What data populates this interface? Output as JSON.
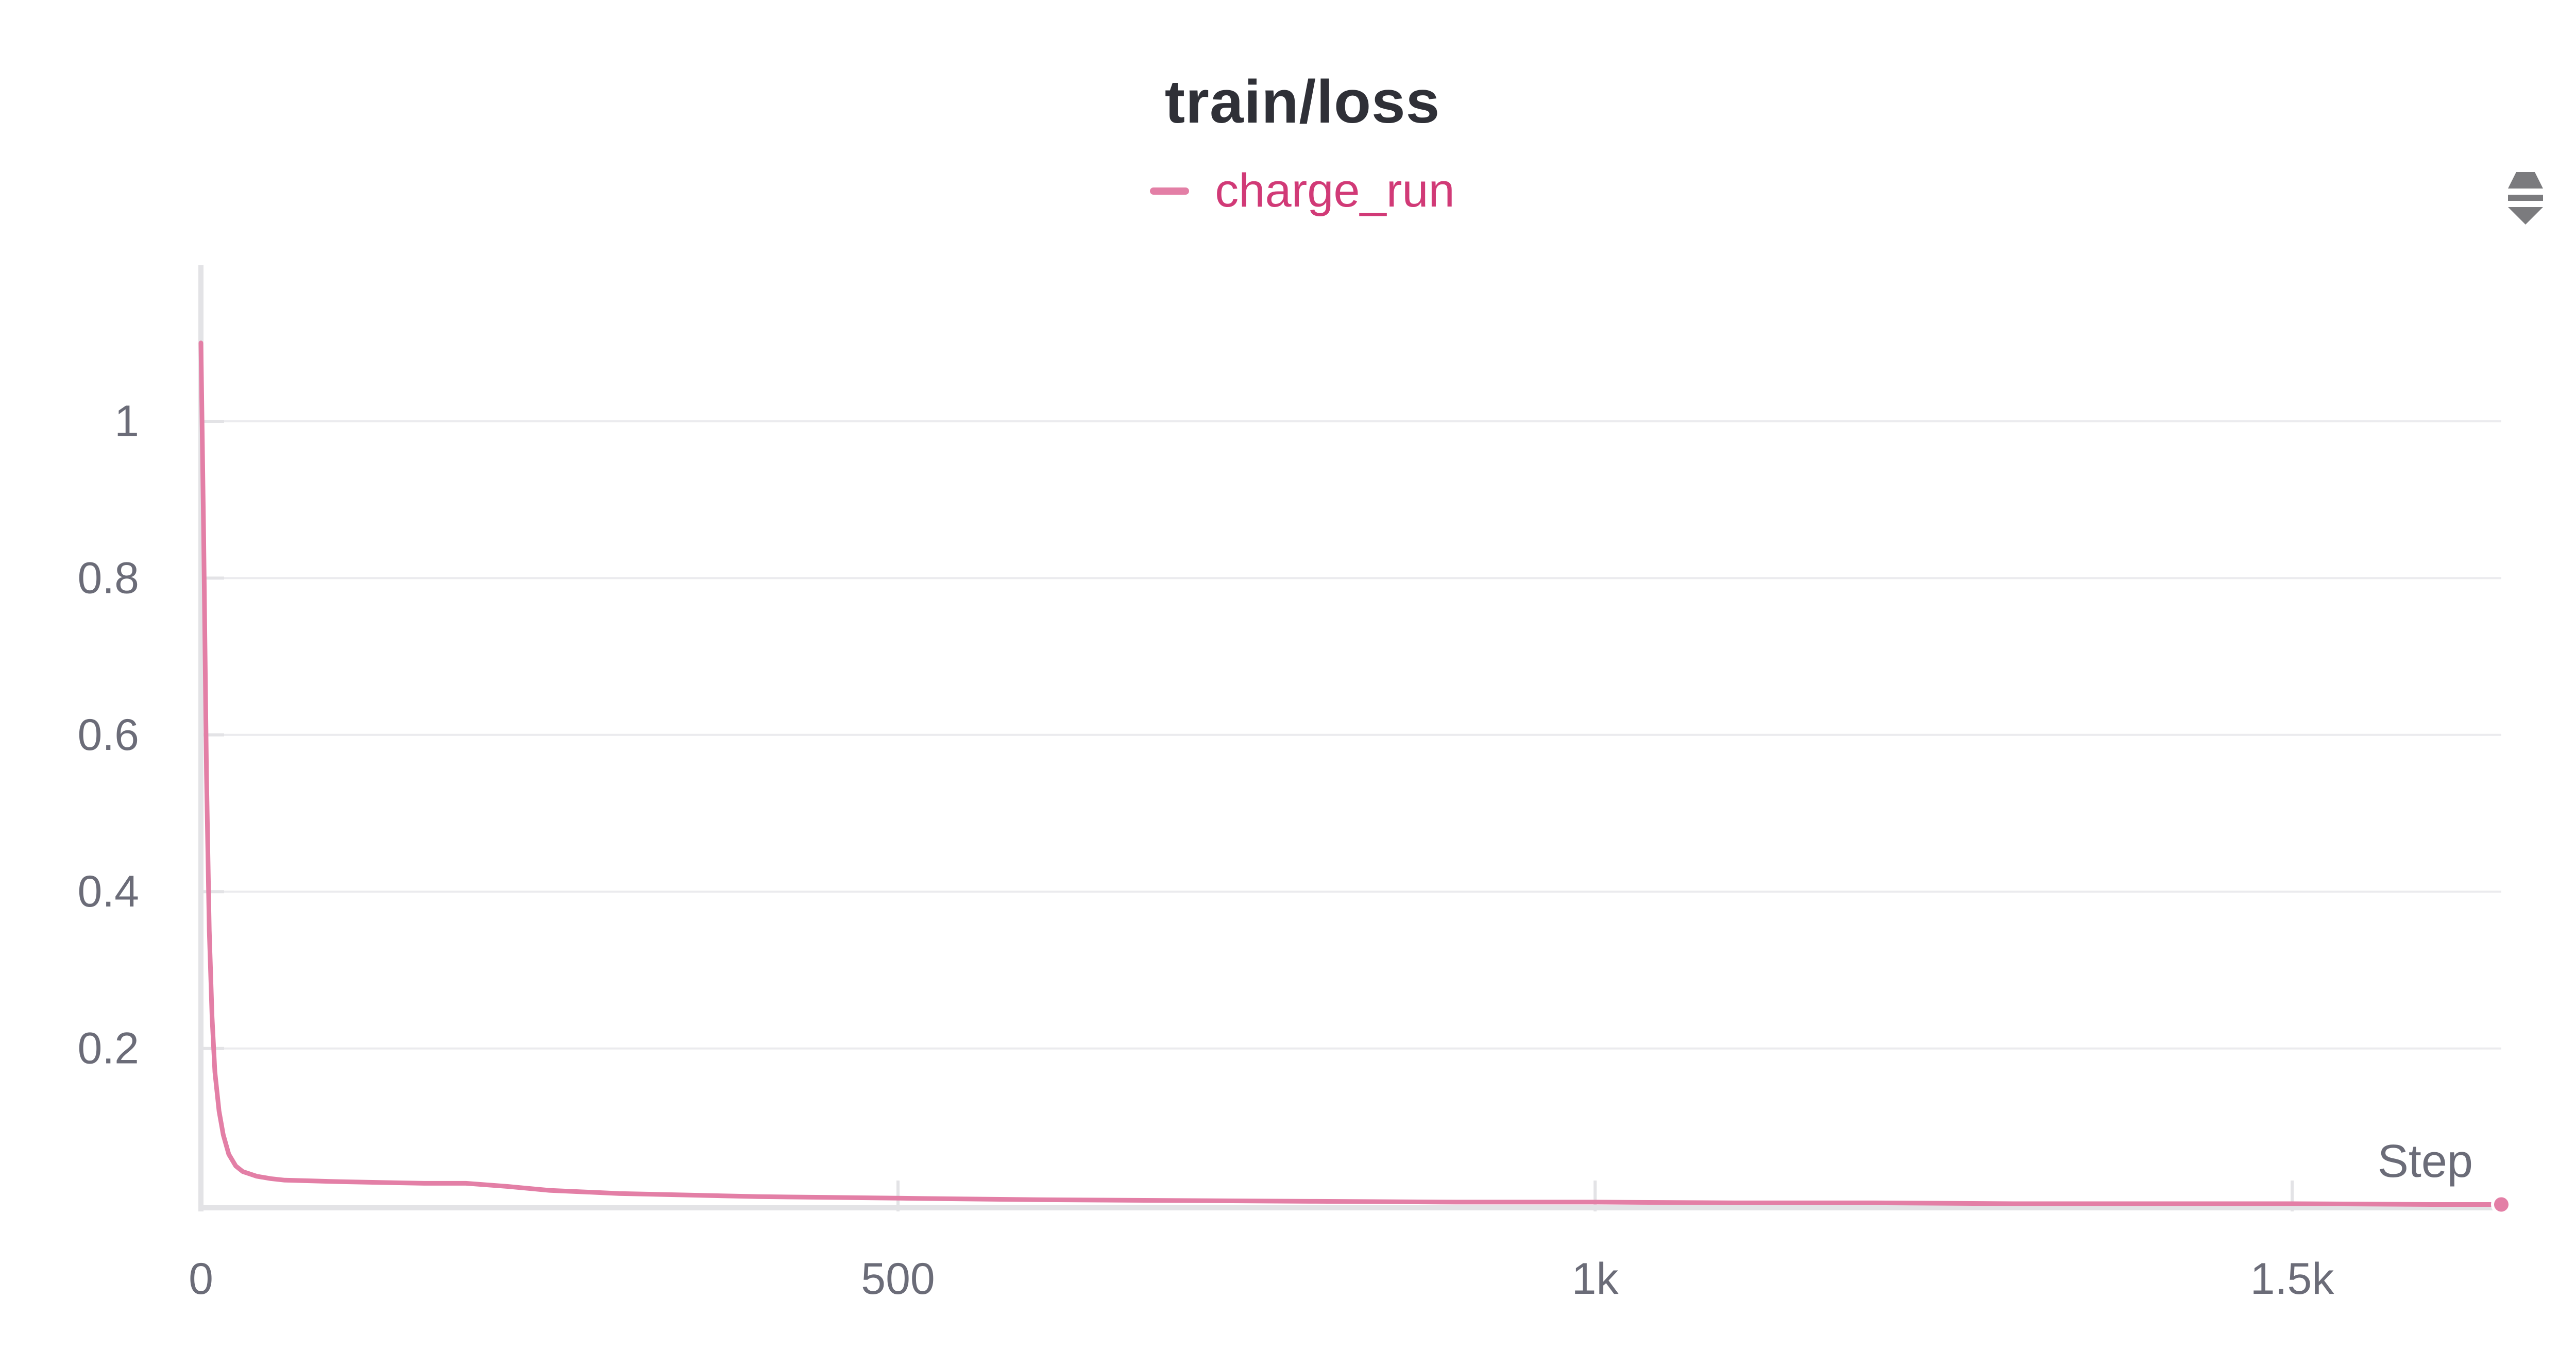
{
  "chart_data": {
    "type": "line",
    "title": "train/loss",
    "xlabel": "Step",
    "ylabel": "",
    "x_ticks": [
      {
        "value": 0,
        "label": "0"
      },
      {
        "value": 500,
        "label": "500"
      },
      {
        "value": 1000,
        "label": "1k"
      },
      {
        "value": 1500,
        "label": "1.5k"
      }
    ],
    "y_ticks": [
      {
        "value": 0.2,
        "label": "0.2"
      },
      {
        "value": 0.4,
        "label": "0.4"
      },
      {
        "value": 0.6,
        "label": "0.6"
      },
      {
        "value": 0.8,
        "label": "0.8"
      },
      {
        "value": 1,
        "label": "1"
      }
    ],
    "xlim": [
      0,
      1650
    ],
    "ylim": [
      0,
      1.2
    ],
    "grid": "horizontal",
    "legend_position": "top-center",
    "series": [
      {
        "name": "charge_run",
        "color": "#e37fa6",
        "x": [
          0,
          2,
          4,
          6,
          8,
          10,
          13,
          16,
          20,
          25,
          30,
          40,
          50,
          60,
          80,
          100,
          130,
          160,
          190,
          220,
          250,
          300,
          350,
          400,
          450,
          500,
          600,
          700,
          800,
          900,
          1000,
          1100,
          1200,
          1300,
          1400,
          1500,
          1600,
          1650
        ],
        "y": [
          1.1,
          0.85,
          0.55,
          0.35,
          0.24,
          0.17,
          0.12,
          0.09,
          0.065,
          0.05,
          0.043,
          0.037,
          0.034,
          0.032,
          0.031,
          0.03,
          0.029,
          0.028,
          0.028,
          0.024,
          0.019,
          0.015,
          0.013,
          0.011,
          0.01,
          0.009,
          0.007,
          0.006,
          0.005,
          0.004,
          0.004,
          0.003,
          0.003,
          0.002,
          0.002,
          0.002,
          0.001,
          0.001
        ]
      }
    ]
  },
  "ui": {
    "menu_icon": "collapse-expand-icon",
    "colors": {
      "legend_text": "#d13a77",
      "axis": "#e3e3e6",
      "grid": "#ebebee",
      "tick_label": "#6b6c78",
      "title": "#2f3037"
    }
  }
}
